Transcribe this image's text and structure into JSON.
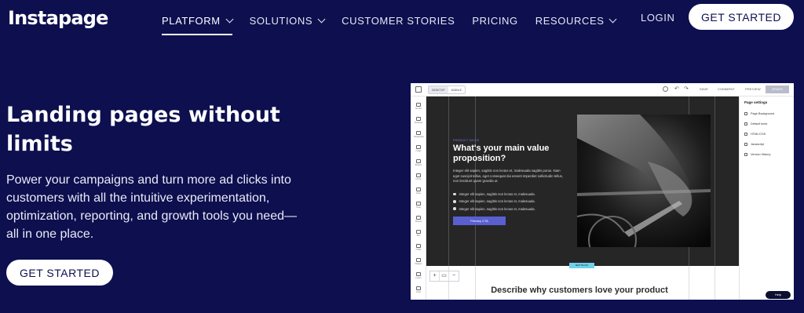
{
  "brand": {
    "logo": "Instapage"
  },
  "nav": {
    "items": [
      {
        "label": "PLATFORM",
        "dropdown": true,
        "active": true
      },
      {
        "label": "SOLUTIONS",
        "dropdown": true,
        "active": false
      },
      {
        "label": "CUSTOMER STORIES",
        "dropdown": false,
        "active": false
      },
      {
        "label": "PRICING",
        "dropdown": false,
        "active": false
      },
      {
        "label": "RESOURCES",
        "dropdown": true,
        "active": false
      }
    ],
    "login": "LOGIN",
    "cta": "GET STARTED"
  },
  "hero": {
    "title": "Landing pages without limits",
    "subtitle": "Power your campaigns and turn more ad clicks into customers with all the intuitive experimentation, optimization, reporting, and growth tools you need—all in one place.",
    "cta": "GET STARTED"
  },
  "editor": {
    "toolbar": {
      "device_tabs": [
        "DESKTOP",
        "MOBILE"
      ],
      "actions": [
        "SAVE",
        "COMMENT",
        "PREVIEW"
      ],
      "update": "UPDATE"
    },
    "tools": [
      "Section",
      "Headings",
      "Paragraphs",
      "Image",
      "Buttons",
      "Forms",
      "Video",
      "Timer",
      "Shapes",
      "Box",
      "HTML",
      "Widgets",
      "Layers",
      "Code"
    ],
    "page": {
      "eyebrow": "PRODUCT SALES",
      "headline": "What's your main value proposition?",
      "paragraph": "Integer elit sapien, sagittis non lectus et, malesuada sagittis purus. Nam eget suscipit tellus, eget consequat dui essent imperdiet sollicitudin tellus, non tincidunt quam gravida ut.",
      "bullets": [
        "Integer elit sapien, sagittis non lectus et, malesuada.",
        "Integer elit sapien, sagittis non lectus et, malesuada.",
        "Integer elit sapien, sagittis non lectus et, malesuada."
      ],
      "cta": "Primary CTA",
      "section_badge": "NEXT BLOCK",
      "next_heading": "Describe why customers love your product"
    },
    "page_settings": {
      "title": "Page settings",
      "items": [
        "Page Background",
        "Default fonts",
        "HTML/CSS",
        "Javascript",
        "Version History"
      ]
    },
    "zoom_controls": [
      "+",
      "▭",
      "−"
    ],
    "help": "Help"
  }
}
